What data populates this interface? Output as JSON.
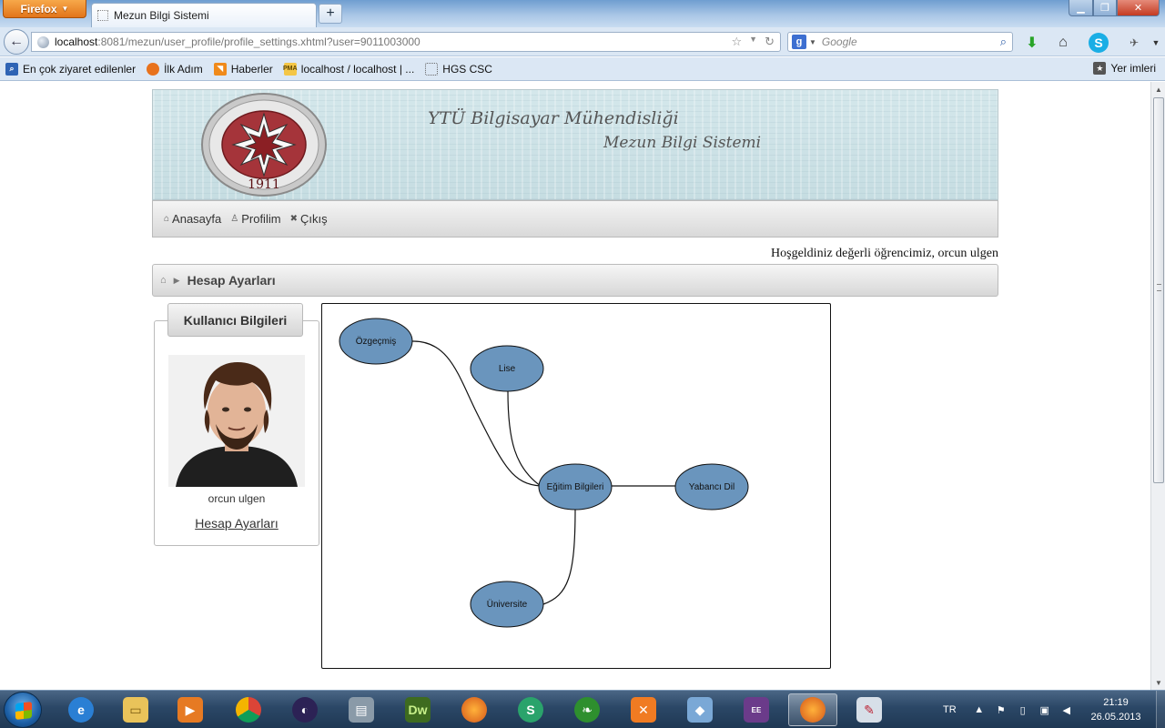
{
  "browser": {
    "app_button": "Firefox",
    "tab_title": "Mezun Bilgi Sistemi",
    "url_host": "localhost",
    "url_path": ":8081/mezun/user_profile/profile_settings.xhtml?user=9011003000",
    "search_placeholder": "Google",
    "bookmarks": [
      "En çok ziyaret edilenler",
      "İlk Adım",
      "Haberler",
      "localhost / localhost | ...",
      "HGS CSC"
    ],
    "bookmarks_right": "Yer imleri",
    "icons": [
      "back-arrow-icon",
      "globe-icon",
      "star-icon",
      "reload-icon",
      "google-icon",
      "search-icon",
      "download-icon",
      "home-icon",
      "skype-icon"
    ]
  },
  "site": {
    "banner_title": "YTÜ Bilgisayar Mühendisliği",
    "banner_subtitle": "Mezun Bilgi Sistemi",
    "seal_text": "YILDIZ TEKNİK ÜNİVERSİTESİ",
    "seal_year": "1911",
    "menu": [
      {
        "label": "Anasayfa",
        "icon": "home-icon"
      },
      {
        "label": "Profilim",
        "icon": "user-icon"
      },
      {
        "label": "Çıkış",
        "icon": "close-icon"
      }
    ],
    "welcome": "Hoşgeldiniz değerli öğrencimiz, orcun ulgen",
    "breadcrumb": "Hesap Ayarları"
  },
  "user_panel": {
    "title": "Kullanıcı Bilgileri",
    "name": "orcun ulgen",
    "link": "Hesap Ayarları"
  },
  "graph": {
    "nodes": {
      "ozgecmis": "Özgeçmiş",
      "lise": "Lise",
      "egitim": "Eğitim Bilgileri",
      "yabanci": "Yabancı Dil",
      "universite": "Üniversite"
    }
  },
  "taskbar": {
    "lang": "TR",
    "time": "21:19",
    "date": "26.05.2013"
  },
  "colors": {
    "node_fill": "#6a95bd",
    "banner_bg": "#cfe3e7",
    "firefox_orange": "#e8801f"
  }
}
